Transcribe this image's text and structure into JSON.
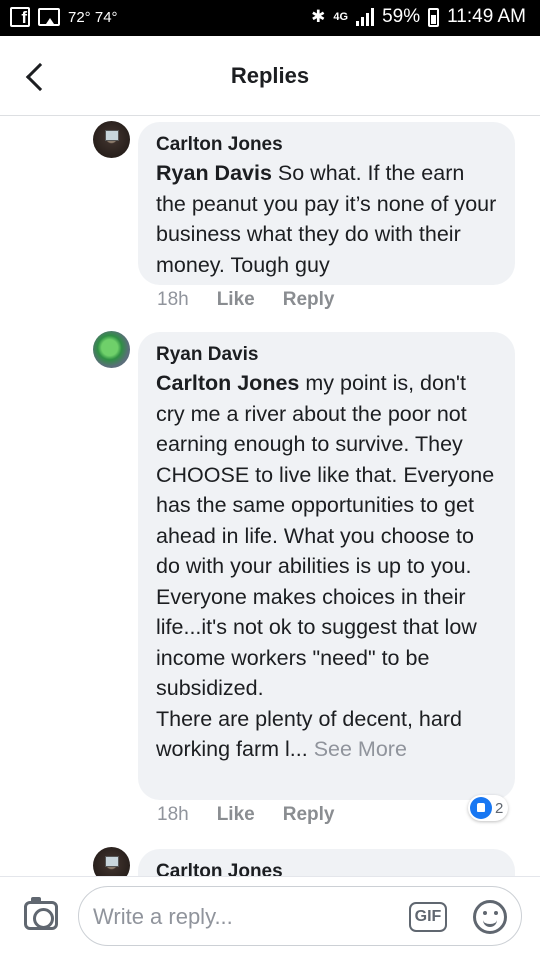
{
  "status_bar": {
    "temps": "72° 74°",
    "network": "4G",
    "battery": "59%",
    "time": "11:49 AM"
  },
  "header": {
    "title": "Replies"
  },
  "comments": [
    {
      "author": "Carlton Jones",
      "mention": "Ryan Davis",
      "text": "  So what. If the earn the peanut you pay it’s none of your business what they do with their money.  Tough guy",
      "time": "18h",
      "like_label": "Like",
      "reply_label": "Reply"
    },
    {
      "author": "Ryan Davis",
      "mention": "Carlton Jones",
      "text": " my point is, don't cry me a river about the poor not earning enough to survive. They CHOOSE to live like that. Everyone has the same opportunities to get ahead in life. What you choose to do with your abilities is up to you. Everyone makes choices in their life...it's not ok to suggest that low income workers \"need\" to be subsidized.\nThere are plenty of decent, hard working farm l...",
      "see_more": " See More",
      "time": "18h",
      "like_label": "Like",
      "reply_label": "Reply",
      "reaction_count": "2"
    },
    {
      "author": "Carlton Jones"
    }
  ],
  "composer": {
    "placeholder": "Write a reply...",
    "gif_label": "GIF"
  }
}
